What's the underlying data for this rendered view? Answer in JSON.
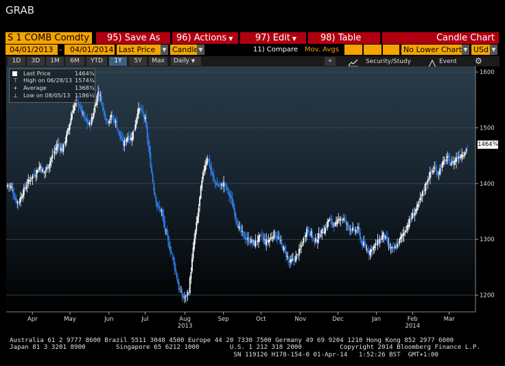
{
  "app_title": "GRAB",
  "menu": {
    "ticker": "S 1 COMB Comdty",
    "save_as": "95) Save As",
    "actions": "96) Actions",
    "edit": "97) Edit",
    "table": "98) Table",
    "chart_type_title": "Candle Chart"
  },
  "controls": {
    "start_date": "04/01/2013",
    "dash": "-",
    "end_date": "04/01/2014",
    "field": "Last Price",
    "style": "Candle",
    "compare": "11) Compare",
    "mov_avgs": "Mov. Avgs",
    "lower_chart": "No Lower Chart",
    "currency": "USd"
  },
  "ranges": [
    "1D",
    "3D",
    "1M",
    "6M",
    "YTD",
    "1Y",
    "5Y",
    "Max"
  ],
  "selected_range": "1Y",
  "frequency": "Daily",
  "toolbar": {
    "security_study": "Security/Study",
    "event": "Event"
  },
  "legend": {
    "last_price_label": "Last Price",
    "last_price_value": "1464¾",
    "high_label": "High on 06/28/13",
    "high_value": "1574¾",
    "average_label": "Average",
    "average_value": "1368¾",
    "low_label": "Low on 08/05/13",
    "low_value": "1186½"
  },
  "last_price_tag": "1464¾",
  "colors": {
    "up": "#ffffff",
    "down": "#2f7ff0",
    "accent_orange": "#f5a300",
    "accent_red": "#b00010"
  },
  "footer": {
    "line1": "Australia 61 2 9777 8600 Brazil 5511 3048 4500 Europe 44 20 7330 7500 Germany 49 69 9204 1210 Hong Kong 852 2977 6000",
    "line2": "Japan 81 3 3201 8900        Singapore 65 6212 1000        U.S. 1 212 318 2000          Copyright 2014 Bloomberg Finance L.P.",
    "line3": "                                                           SN 119126 H178-154-0 01-Apr-14   1:52:26 BST  GMT+1:00"
  },
  "chart_data": {
    "type": "candlestick",
    "title": "",
    "ylim": [
      1170,
      1610
    ],
    "y_ticks": [
      1200,
      1300,
      1400,
      1500,
      1600
    ],
    "x_ticks": [
      {
        "label": "Apr",
        "pos": 0.015
      },
      {
        "label": "May",
        "pos": 0.095
      },
      {
        "label": "Jun",
        "pos": 0.178
      },
      {
        "label": "Jul",
        "pos": 0.255
      },
      {
        "label": "Aug",
        "pos": 0.34
      },
      {
        "label": "Sep",
        "pos": 0.422
      },
      {
        "label": "Oct",
        "pos": 0.502
      },
      {
        "label": "Nov",
        "pos": 0.586
      },
      {
        "label": "Dec",
        "pos": 0.666
      },
      {
        "label": "Jan",
        "pos": 0.748
      },
      {
        "label": "Feb",
        "pos": 0.825
      },
      {
        "label": "Mar",
        "pos": 0.903
      }
    ],
    "year_labels": [
      {
        "label": "2013",
        "pos": 0.34
      },
      {
        "label": "2014",
        "pos": 0.825
      }
    ],
    "close_path": [
      [
        0,
        1398
      ],
      [
        4,
        1392
      ],
      [
        7,
        1372
      ],
      [
        10,
        1365
      ],
      [
        14,
        1385
      ],
      [
        18,
        1400
      ],
      [
        22,
        1412
      ],
      [
        26,
        1420
      ],
      [
        30,
        1432
      ],
      [
        33,
        1418
      ],
      [
        36,
        1428
      ],
      [
        40,
        1445
      ],
      [
        43,
        1458
      ],
      [
        46,
        1470
      ],
      [
        50,
        1460
      ],
      [
        53,
        1478
      ],
      [
        56,
        1500
      ],
      [
        60,
        1535
      ],
      [
        63,
        1548
      ],
      [
        66,
        1540
      ],
      [
        69,
        1522
      ],
      [
        72,
        1512
      ],
      [
        75,
        1505
      ],
      [
        78,
        1520
      ],
      [
        80,
        1540
      ],
      [
        83,
        1565
      ],
      [
        85,
        1555
      ],
      [
        88,
        1530
      ],
      [
        91,
        1512
      ],
      [
        95,
        1520
      ],
      [
        99,
        1510
      ],
      [
        102,
        1490
      ],
      [
        106,
        1470
      ],
      [
        110,
        1485
      ],
      [
        113,
        1480
      ],
      [
        116,
        1498
      ],
      [
        119,
        1530
      ],
      [
        122,
        1532
      ],
      [
        126,
        1515
      ],
      [
        130,
        1450
      ],
      [
        134,
        1390
      ],
      [
        137,
        1360
      ],
      [
        141,
        1350
      ],
      [
        144,
        1320
      ],
      [
        147,
        1295
      ],
      [
        151,
        1270
      ],
      [
        154,
        1242
      ],
      [
        157,
        1212
      ],
      [
        160,
        1197
      ],
      [
        163,
        1195
      ],
      [
        166,
        1208
      ],
      [
        168,
        1245
      ],
      [
        171,
        1300
      ],
      [
        174,
        1340
      ],
      [
        177,
        1390
      ],
      [
        180,
        1428
      ],
      [
        183,
        1448
      ],
      [
        186,
        1425
      ],
      [
        189,
        1405
      ],
      [
        192,
        1398
      ],
      [
        195,
        1395
      ],
      [
        198,
        1400
      ],
      [
        201,
        1390
      ],
      [
        205,
        1370
      ],
      [
        209,
        1340
      ],
      [
        212,
        1320
      ],
      [
        215,
        1310
      ],
      [
        219,
        1300
      ],
      [
        222,
        1298
      ],
      [
        226,
        1292
      ],
      [
        229,
        1300
      ],
      [
        233,
        1305
      ],
      [
        236,
        1295
      ],
      [
        240,
        1300
      ],
      [
        244,
        1310
      ],
      [
        248,
        1302
      ],
      [
        251,
        1290
      ],
      [
        255,
        1275
      ],
      [
        258,
        1258
      ],
      [
        261,
        1262
      ],
      [
        265,
        1270
      ],
      [
        268,
        1282
      ],
      [
        271,
        1300
      ],
      [
        274,
        1318
      ],
      [
        278,
        1310
      ],
      [
        281,
        1295
      ],
      [
        284,
        1303
      ],
      [
        287,
        1312
      ],
      [
        291,
        1320
      ],
      [
        294,
        1335
      ],
      [
        297,
        1330
      ],
      [
        301,
        1325
      ],
      [
        304,
        1340
      ],
      [
        308,
        1336
      ],
      [
        311,
        1325
      ],
      [
        315,
        1318
      ],
      [
        318,
        1315
      ],
      [
        321,
        1318
      ],
      [
        324,
        1295
      ],
      [
        328,
        1285
      ],
      [
        331,
        1278
      ],
      [
        334,
        1283
      ],
      [
        337,
        1290
      ],
      [
        341,
        1300
      ],
      [
        344,
        1308
      ],
      [
        347,
        1298
      ],
      [
        350,
        1285
      ],
      [
        353,
        1280
      ],
      [
        357,
        1290
      ],
      [
        360,
        1302
      ],
      [
        363,
        1312
      ],
      [
        366,
        1325
      ],
      [
        370,
        1340
      ],
      [
        373,
        1350
      ],
      [
        376,
        1360
      ],
      [
        379,
        1378
      ],
      [
        382,
        1392
      ],
      [
        385,
        1410
      ],
      [
        388,
        1420
      ],
      [
        391,
        1428
      ],
      [
        394,
        1418
      ],
      [
        397,
        1430
      ],
      [
        400,
        1440
      ],
      [
        403,
        1445
      ],
      [
        406,
        1436
      ],
      [
        409,
        1440
      ],
      [
        412,
        1448
      ],
      [
        415,
        1452
      ],
      [
        418,
        1455
      ],
      [
        421,
        1464
      ]
    ]
  }
}
